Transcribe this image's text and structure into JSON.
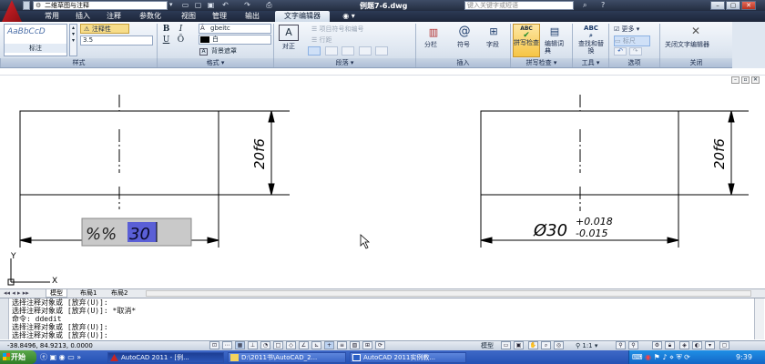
{
  "titlebar": {
    "workspace": "二维草图与注释",
    "document_title": "例题7-6.dwg",
    "help_search_placeholder": "键入关键字或短语",
    "qat_icons": [
      "new-icon",
      "open-icon",
      "save-icon",
      "undo-icon",
      "redo-icon",
      "plot-icon"
    ],
    "window_buttons": [
      "minimize",
      "maximize",
      "close"
    ]
  },
  "tabs": [
    "常用",
    "插入",
    "注释",
    "参数化",
    "视图",
    "管理",
    "输出",
    "文字编辑器"
  ],
  "ribbon": {
    "style": {
      "preview_text": "AaBbCcD",
      "style_name": "标注",
      "annotative_label": "注释性",
      "text_height": "3.5",
      "panel_label": "样式"
    },
    "format": {
      "bold": "B",
      "italic": "I",
      "underline": "U",
      "overline": "Ō",
      "font": "gbeitc",
      "color": "白",
      "background_mask": "背景遮罩",
      "panel_label": "格式"
    },
    "paragraph": {
      "justify_label": "对正",
      "bullets": "项目符号和编号",
      "line_spacing": "行距",
      "panel_label": "段落"
    },
    "insert": {
      "columns": "分栏",
      "symbol": "符号",
      "field": "字段",
      "panel_label": "插入"
    },
    "spell": {
      "spell_check": "拼写检查",
      "edit_dictionary": "编辑词典",
      "panel_label": "拼写检查"
    },
    "tools": {
      "find_replace": "查找和替换",
      "panel_label": "工具"
    },
    "options": {
      "more": "更多",
      "ruler": "标尺",
      "panel_label": "选项"
    },
    "close": {
      "close_editor": "关闭文字编辑器",
      "panel_label": "关闭"
    }
  },
  "drawing": {
    "left_dim_vertical": "20f6",
    "edit_text_prefix": "%%",
    "edit_text_selected": "30",
    "right_dim_vertical": "20f6",
    "right_dim_main": "Ø30",
    "tol_upper": "+0.018",
    "tol_lower": "-0.015",
    "ucs_x": "X",
    "ucs_y": "Y"
  },
  "layout_tabs": [
    "模型",
    "布局1",
    "布局2"
  ],
  "command_lines": [
    "选择注释对象或 [放弃(U)]:",
    "选择注释对象或 [放弃(U)]: *取消*",
    "命令: ddedit",
    "选择注释对象或 [放弃(U)]:",
    "选择注释对象或 [放弃(U)]:"
  ],
  "status": {
    "coords": "-38.8496, 84.9213, 0.0000",
    "model_label": "模型",
    "scale": "1:1"
  },
  "taskbar": {
    "start": "开始",
    "tasks": [
      "AutoCAD 2011 - [例...",
      "D:\\2011书\\AutoCAD_2...",
      "AutoCAD 2011实例教..."
    ],
    "clock": "9:39"
  },
  "colors": {
    "selection": "#5a5fd6",
    "ribbon_bg": "#dfe7f1",
    "titlebar": "#2c3a55"
  }
}
